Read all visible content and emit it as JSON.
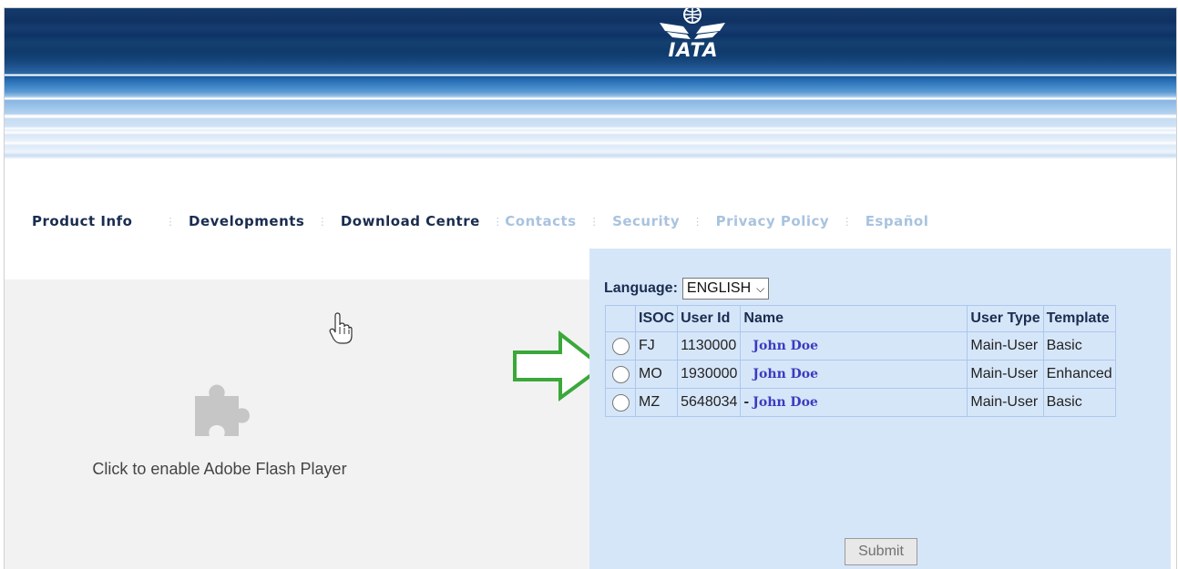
{
  "header": {
    "logo_text": "IATA"
  },
  "nav": {
    "items": [
      {
        "label": "Product Info",
        "style": "dark"
      },
      {
        "label": "Developments",
        "style": "dark"
      },
      {
        "label": "Download Centre",
        "style": "dark"
      },
      {
        "label": "Contacts",
        "style": "light"
      },
      {
        "label": "Security",
        "style": "light"
      },
      {
        "label": "Privacy Policy",
        "style": "light"
      },
      {
        "label": "Español",
        "style": "light"
      }
    ],
    "separator": "⋮"
  },
  "flash": {
    "message": "Click to enable Adobe Flash Player",
    "icon": "puzzle-piece-icon"
  },
  "annotation": {
    "icon": "arrow-right-icon",
    "color": "#3aa83a"
  },
  "panel": {
    "language_label": "Language:",
    "language_value": "ENGLISH",
    "table": {
      "headers": [
        "",
        "ISOC",
        "User Id",
        "Name",
        "User Type",
        "Template"
      ],
      "rows": [
        {
          "isoc": "FJ",
          "user_id": "1130000",
          "name_prefix": "",
          "name": "John Doe",
          "user_type": "Main-User",
          "template": "Basic"
        },
        {
          "isoc": "MO",
          "user_id": "1930000",
          "name_prefix": "",
          "name": "John Doe",
          "user_type": "Main-User",
          "template": "Enhanced"
        },
        {
          "isoc": "MZ",
          "user_id": "5648034",
          "name_prefix": "-",
          "name": "John Doe",
          "user_type": "Main-User",
          "template": "Basic"
        }
      ]
    },
    "submit_label": "Submit"
  },
  "colors": {
    "header_dark": "#0f3263",
    "nav_dark": "#1a2d50",
    "nav_light": "#a9c3e0",
    "panel_bg": "#d6e6f9",
    "name_link": "#3b3bbf"
  }
}
